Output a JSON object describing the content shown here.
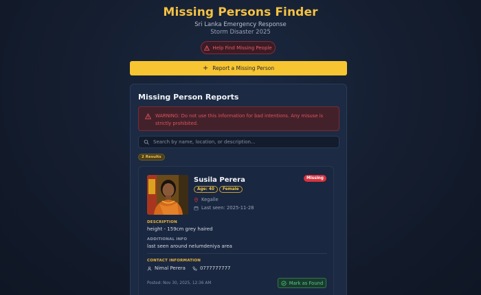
{
  "header": {
    "title": "Missing Persons Finder",
    "subtitle_line1": "Sri Lanka Emergency Response",
    "subtitle_line2": "Storm Disaster 2025",
    "help_badge": "Help Find Missing People"
  },
  "actions": {
    "report_button": "Report a Missing Person"
  },
  "reports": {
    "title": "Missing Person Reports",
    "warning": "WARNING: Do not use this information for bad intentions. Any misuse is strictly prohibited.",
    "search_placeholder": "Search by name, location, or description...",
    "results_count": "2 Results",
    "cards": [
      {
        "name": "Susila Perera",
        "status": "Missing",
        "age": "Age: 40",
        "gender": "Female",
        "location": "Kegalle",
        "last_seen": "Last seen: 2025-11-28",
        "description_label": "DESCRIPTION",
        "description": "height - 159cm grey haired",
        "additional_label": "ADDITIONAL INFO",
        "additional": "last seen around nelumdeniya area",
        "contact_label": "CONTACT INFORMATION",
        "contact_name": "Nimal Perera",
        "contact_phone": "0777777777",
        "posted": "Posted: Nov 30, 2025, 12:36 AM",
        "found_button": "Mark as Found"
      }
    ]
  },
  "colors": {
    "accent_yellow": "#f7c532",
    "danger_red": "#d9323f",
    "success_green": "#4fd07a",
    "panel_bg": "#1c2b43"
  }
}
